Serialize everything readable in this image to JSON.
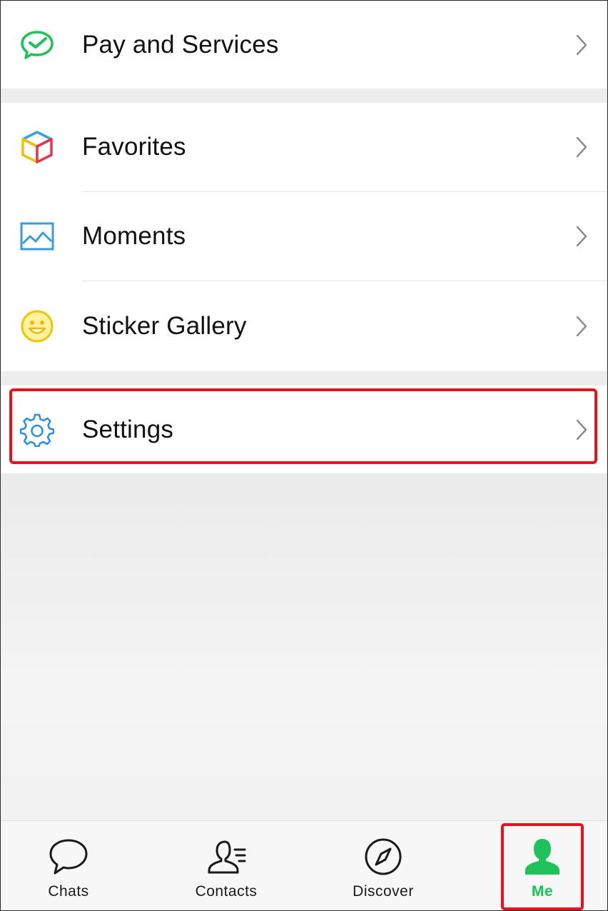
{
  "menu": {
    "pay_services": {
      "label": "Pay and Services",
      "icon": "wallet-check-icon"
    },
    "favorites": {
      "label": "Favorites",
      "icon": "cube-icon"
    },
    "moments": {
      "label": "Moments",
      "icon": "picture-icon"
    },
    "sticker_gallery": {
      "label": "Sticker Gallery",
      "icon": "smiley-icon"
    },
    "settings": {
      "label": "Settings",
      "icon": "gear-icon"
    }
  },
  "tabbar": {
    "tabs": [
      {
        "label": "Chats",
        "icon": "chat-bubble-icon"
      },
      {
        "label": "Contacts",
        "icon": "contacts-icon"
      },
      {
        "label": "Discover",
        "icon": "compass-icon"
      },
      {
        "label": "Me",
        "icon": "person-icon",
        "active": true
      }
    ]
  },
  "colors": {
    "accent_green": "#1fc15a",
    "highlight_red": "#e8111c",
    "settings_blue": "#2b8de6"
  }
}
